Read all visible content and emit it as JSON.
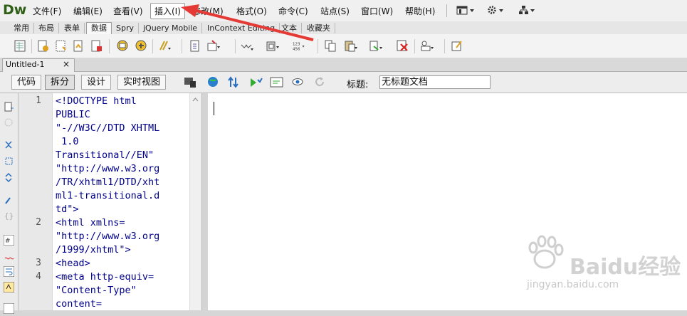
{
  "app": {
    "logo": "Dw"
  },
  "menu": [
    {
      "label": "文件(F)"
    },
    {
      "label": "编辑(E)"
    },
    {
      "label": "查看(V)"
    },
    {
      "label": "插入(I)"
    },
    {
      "label": "修改(M)"
    },
    {
      "label": "格式(O)"
    },
    {
      "label": "命令(C)"
    },
    {
      "label": "站点(S)"
    },
    {
      "label": "窗口(W)"
    },
    {
      "label": "帮助(H)"
    }
  ],
  "insert_tabs": [
    "常用",
    "布局",
    "表单",
    "数据",
    "Spry",
    "jQuery Mobile",
    "InContext Editing",
    "文本",
    "收藏夹"
  ],
  "selected_tab": "数据",
  "document": {
    "tab_name": "Untitled-1",
    "close": "×"
  },
  "view_buttons": [
    "代码",
    "拆分",
    "设计",
    "实时视图"
  ],
  "active_view": "拆分",
  "title_label": "标题:",
  "title_value": "无标题文档",
  "code": {
    "line_numbers": [
      "1",
      "2",
      "3",
      "4"
    ],
    "lines": [
      "<!DOCTYPE html",
      "PUBLIC",
      "\"-//W3C//DTD XHTML",
      " 1.0",
      "Transitional//EN\"",
      "\"http://www.w3.org",
      "/TR/xhtml1/DTD/xht",
      "ml1-transitional.d",
      "td\">",
      "<html xmlns=",
      "\"http://www.w3.org",
      "/1999/xhtml\">",
      "<head>",
      "<meta http-equiv=",
      "\"Content-Type\"",
      "content="
    ]
  },
  "watermark": {
    "brand": "Baidu经验",
    "url": "jingyan.baidu.com"
  },
  "colors": {
    "logo": "#2f5f16",
    "code": "#00008b",
    "arrow": "#e53935"
  }
}
